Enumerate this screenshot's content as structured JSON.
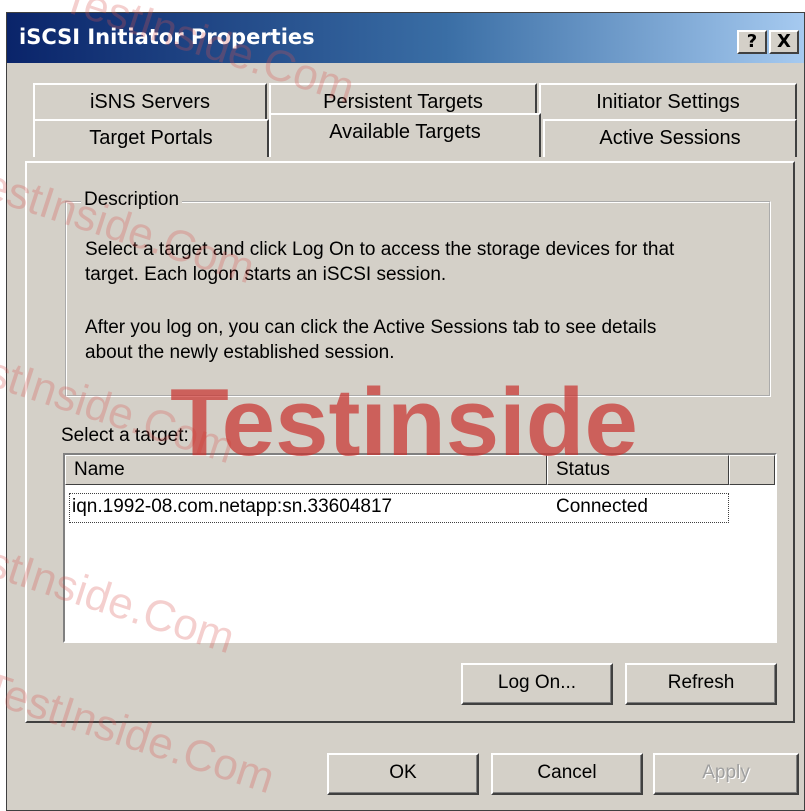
{
  "window": {
    "title": "iSCSI Initiator Properties",
    "help_label": "?",
    "close_label": "X"
  },
  "tabs": {
    "row_back": [
      "iSNS Servers",
      "Persistent Targets",
      "Initiator Settings"
    ],
    "row_front": [
      "Target Portals",
      "Available Targets",
      "Active Sessions"
    ],
    "active": "Available Targets"
  },
  "description": {
    "legend": "Description",
    "line1": "Select a target and click Log On to access the storage devices for that",
    "line2": "target. Each logon starts an iSCSI session.",
    "line3": "After you log on, you can click the Active Sessions tab to see details",
    "line4": "about the newly established session."
  },
  "targets": {
    "label": "Select a target:",
    "columns": [
      "Name",
      "Status"
    ],
    "rows": [
      {
        "name": "iqn.1992-08.com.netapp:sn.33604817",
        "status": "Connected"
      }
    ]
  },
  "buttons": {
    "logon": "Log On...",
    "refresh": "Refresh",
    "ok": "OK",
    "cancel": "Cancel",
    "apply": "Apply"
  },
  "watermark": {
    "main": "Testinside",
    "repeat": "TestInside.Com"
  }
}
